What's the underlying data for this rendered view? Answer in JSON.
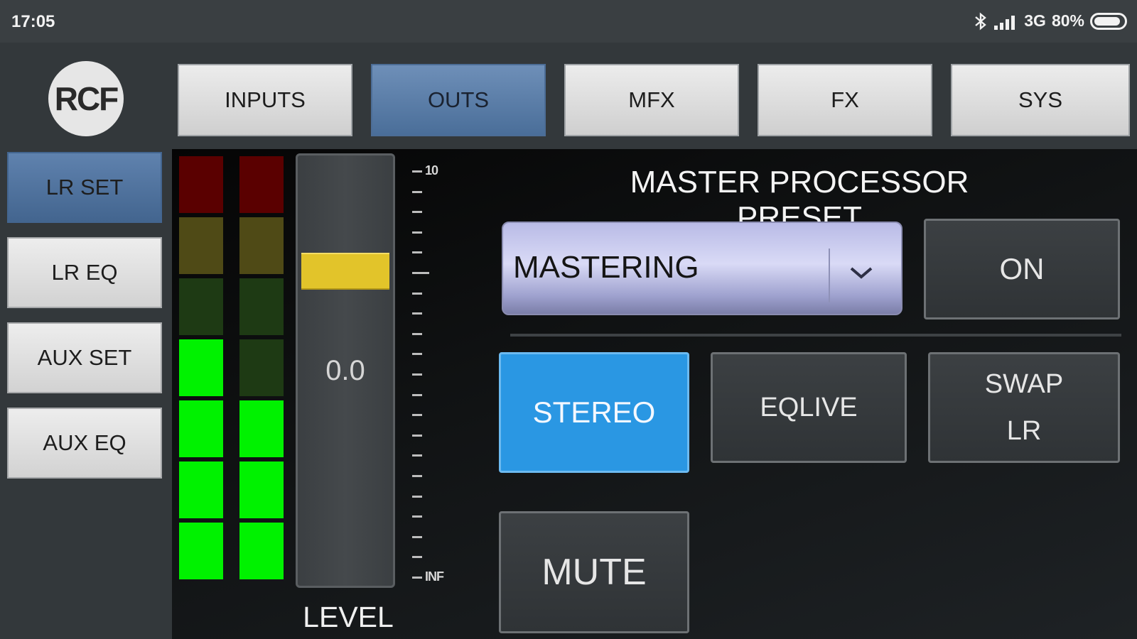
{
  "status_bar": {
    "time": "17:05",
    "network": "3G",
    "battery": "80%",
    "icons": [
      "bluetooth-icon",
      "signal-icon",
      "battery-icon"
    ]
  },
  "logo": {
    "text": "RCF"
  },
  "top_tabs": [
    {
      "label": "INPUTS",
      "active": false
    },
    {
      "label": "OUTS",
      "active": true
    },
    {
      "label": "MFX",
      "active": false
    },
    {
      "label": "FX",
      "active": false
    },
    {
      "label": "SYS",
      "active": false
    }
  ],
  "side_nav": [
    {
      "label": "LR SET",
      "active": true
    },
    {
      "label": "LR EQ",
      "active": false
    },
    {
      "label": "AUX SET",
      "active": false
    },
    {
      "label": "AUX EQ",
      "active": false
    }
  ],
  "fader": {
    "value": "0.0",
    "label": "LEVEL",
    "scale_top": "10",
    "scale_bottom": "INF"
  },
  "meters": {
    "left_lit_segments": 4,
    "right_lit_segments": 3,
    "colors": {
      "green": "#00f200",
      "dark_green": "#1e3a14",
      "yellow": "#4f4a16",
      "red": "#5a0000"
    }
  },
  "preset": {
    "title": "MASTER PROCESSOR PRESET",
    "selected": "MASTERING",
    "on_label": "ON"
  },
  "buttons": {
    "stereo": "STEREO",
    "eqlive": "EQLIVE",
    "swap_line1": "SWAP",
    "swap_line2": "LR",
    "mute": "MUTE"
  },
  "colors": {
    "accent_blue": "#2a97e3",
    "tab_active": "#5a7ba6",
    "fader_knob": "#e2c42a"
  }
}
